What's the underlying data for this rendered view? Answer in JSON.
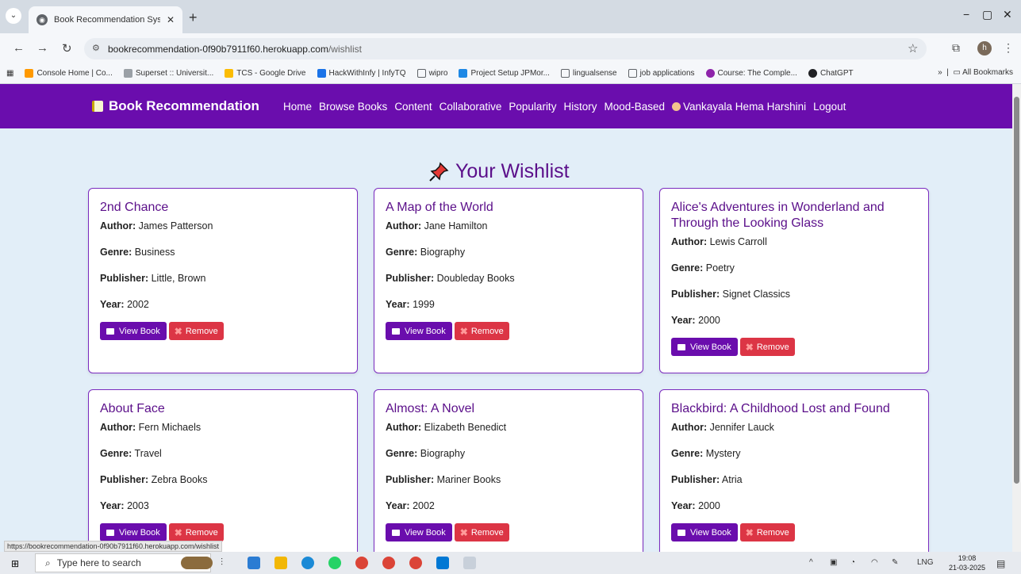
{
  "browser": {
    "tab_title": "Book Recommendation System",
    "tab_close": "✕",
    "new_tab": "+",
    "url_host": "bookrecommendation-0f90b7911f60.herokuapp.com",
    "url_path": "/wishlist",
    "win_min": "−",
    "win_max": "▢",
    "win_close": "✕",
    "profile_initial": "h",
    "bookmarks": [
      {
        "label": "Console Home | Co...",
        "color": "#ff9900"
      },
      {
        "label": "Superset :: Universit...",
        "color": "#9aa0a6"
      },
      {
        "label": "TCS - Google Drive",
        "color": "#fbbc04"
      },
      {
        "label": "HackWithInfy | InfyTQ",
        "color": "#1a73e8"
      },
      {
        "label": "wipro",
        "color": "#5f6368"
      },
      {
        "label": "Project Setup JPMor...",
        "color": "#1e88e5"
      },
      {
        "label": "lingualsense",
        "color": "#5f6368"
      },
      {
        "label": "job applications",
        "color": "#5f6368"
      },
      {
        "label": "Course: The Comple...",
        "color": "#8e24aa"
      },
      {
        "label": "ChatGPT",
        "color": "#202124"
      }
    ],
    "bookmarks_more": "»",
    "all_bookmarks": "All Bookmarks",
    "status_url": "https://bookrecommendation-0f90b7911f60.herokuapp.com/wishlist"
  },
  "nav": {
    "brand": "Book Recommendation",
    "links": [
      "Home",
      "Browse Books",
      "Content",
      "Collaborative",
      "Popularity",
      "History",
      "Mood-Based"
    ],
    "user": "Vankayala Hema Harshini",
    "logout": "Logout"
  },
  "heading": "Your Wishlist",
  "labels": {
    "author": "Author:",
    "genre": "Genre:",
    "publisher": "Publisher:",
    "year": "Year:",
    "view": "View Book",
    "remove": "Remove"
  },
  "books": [
    {
      "title": "2nd Chance",
      "author": "James Patterson",
      "genre": "Business",
      "publisher": "Little, Brown",
      "year": "2002"
    },
    {
      "title": "A Map of the World",
      "author": "Jane Hamilton",
      "genre": "Biography",
      "publisher": "Doubleday Books",
      "year": "1999"
    },
    {
      "title": "Alice's Adventures in Wonderland and Through the Looking Glass",
      "author": "Lewis Carroll",
      "genre": "Poetry",
      "publisher": "Signet Classics",
      "year": "2000"
    },
    {
      "title": "About Face",
      "author": "Fern Michaels",
      "genre": "Travel",
      "publisher": "Zebra Books",
      "year": "2003"
    },
    {
      "title": "Almost: A Novel",
      "author": "Elizabeth Benedict",
      "genre": "Biography",
      "publisher": "Mariner Books",
      "year": "2002"
    },
    {
      "title": "Blackbird: A Childhood Lost and Found",
      "author": "Jennifer Lauck",
      "genre": "Mystery",
      "publisher": "Atria",
      "year": "2000"
    }
  ],
  "taskbar": {
    "search_placeholder": "Type here to search",
    "tray_lang": "LNG",
    "time": "19:08",
    "date": "21-03-2025"
  },
  "colors": {
    "navbar": "#6a0dad",
    "page_bg": "#e2eef8",
    "remove": "#dc3545",
    "title": "#5b0f8a"
  }
}
